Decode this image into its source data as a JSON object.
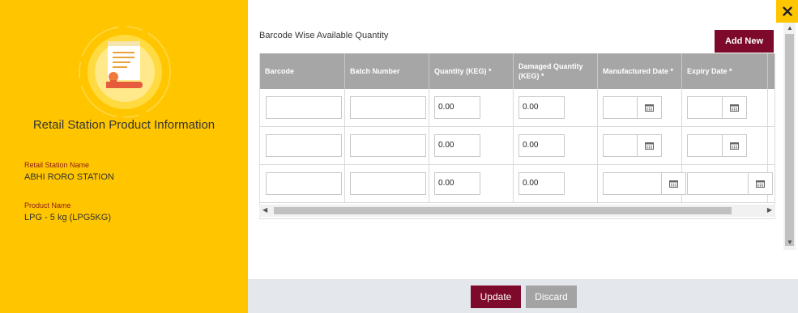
{
  "left_panel": {
    "title": "Retail Station Product Information",
    "fields": [
      {
        "label": "Retail Station Name",
        "value": "ABHI RORO STATION"
      },
      {
        "label": "Product Name",
        "value": "LPG - 5 kg (LPG5KG)"
      }
    ],
    "emblem_icon": "certificate-document-icon"
  },
  "main": {
    "section_title": "Barcode Wise Available Quantity",
    "add_new_label": "Add New",
    "columns": [
      "Barcode",
      "Batch Number",
      "Quantity (KEG) *",
      "Damaged Quantity (KEG) *",
      "Manufactured Date *",
      "Expiry Date *"
    ],
    "rows": [
      {
        "barcode": "",
        "batch": "",
        "quantity": "0.00",
        "damaged": "0.00",
        "manufactured": "",
        "expiry": ""
      },
      {
        "barcode": "",
        "batch": "",
        "quantity": "0.00",
        "damaged": "0.00",
        "manufactured": "",
        "expiry": ""
      },
      {
        "barcode": "",
        "batch": "",
        "quantity": "0.00",
        "damaged": "0.00",
        "manufactured": "",
        "expiry": ""
      }
    ]
  },
  "footer": {
    "update_label": "Update",
    "discard_label": "Discard"
  },
  "colors": {
    "accent_yellow": "#ffc600",
    "primary_maroon": "#7d0a2a",
    "header_gray": "#a6a6a6",
    "discard_gray": "#a3a3a3"
  }
}
